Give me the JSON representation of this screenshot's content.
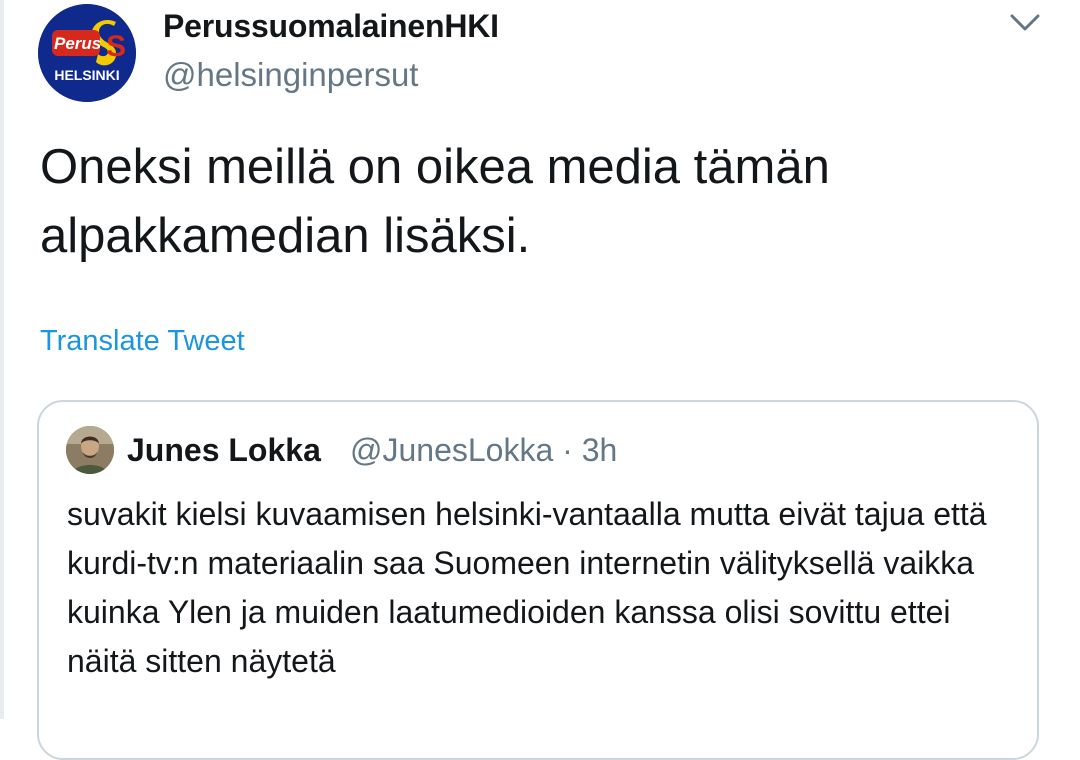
{
  "tweet": {
    "display_name": "PerussuomalainenHKI",
    "handle": "@helsinginpersut",
    "text": "Oneksi meillä on oikea media tämän alpakkamedian lisäksi.",
    "translate_label": "Translate Tweet",
    "avatar": {
      "logo_word": "Perus",
      "logo_letter": "S",
      "city": "HELSINKI",
      "colors": {
        "background": "#0f2a8c",
        "logo_red": "#d6291e",
        "logo_yellow": "#f3c900"
      }
    },
    "more_icon": "chevron-down-icon"
  },
  "quoted_tweet": {
    "display_name": "Junes Lokka",
    "handle": "@JunesLokka",
    "separator": "·",
    "time": "3h",
    "text": "suvakit kielsi kuvaamisen helsinki-vantaalla mutta eivät tajua että kurdi-tv:n materiaalin saa Suomeen internetin välityksellä vaikka kuinka Ylen ja muiden laatumedioiden kanssa olisi sovittu ettei näitä sitten näytetä"
  },
  "colors": {
    "text": "#14171a",
    "secondary": "#657786",
    "link": "#1b95e0",
    "border": "#ccd6dd"
  }
}
